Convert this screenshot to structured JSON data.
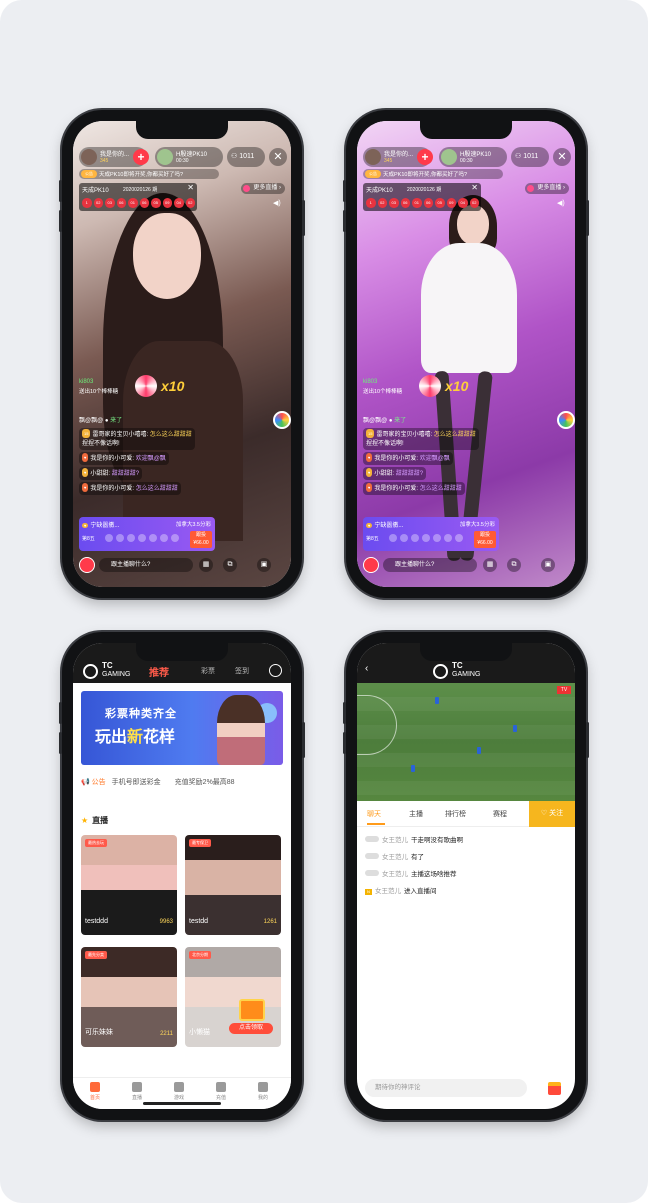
{
  "stream1": {
    "anchor_name": "我是你的...",
    "anchor_fans": "345",
    "pk_title": "H殷速PK10",
    "pk_time": "00:30",
    "viewers": "1011",
    "notice_badge": "公告",
    "notice_text": "天成PK10即将开奖,你都买好了吗?",
    "lottery_title": "天成PK10",
    "lottery_period": "2020020126 期",
    "lottery_balls": [
      "1",
      "02",
      "03",
      "06",
      "01",
      "06",
      "05",
      "09",
      "04",
      "02"
    ],
    "more_live": "更多直播",
    "gift_user": "ki803",
    "gift_text": "送出10个棒棒糖",
    "gift_multiplier": "x10",
    "chat_line1_user": "飘@飘@",
    "chat_line1_text": "来了",
    "chat_line2_lv": "15",
    "chat_line2_user": "雷哥家的宝贝小嘻嘻:",
    "chat_line2_text": "怎么这么甜甜甜",
    "chat_line2_cont": "捏捏不像话啊!",
    "chat_line3_user": "我是你的小可爱:",
    "chat_line3_text": "欢迎飘@飘",
    "chat_line4_user": "小甜甜:",
    "chat_line4_text": "甜甜甜甜?",
    "chat_line5_user": "我是你的小可爱:",
    "chat_line5_text": "怎么这么甜甜甜",
    "bet_user": "宁缺嚣擻...",
    "bet_text": "加拿大3.5分彩",
    "bet_label": "第8五",
    "bet_btn_top": "跟投",
    "bet_btn_bottom": "¥66.00",
    "chat_placeholder": "跟主播聊什么?"
  },
  "stream2": {
    "anchor_name": "我是你的...",
    "anchor_fans": "345",
    "pk_title": "H殷速PK10",
    "pk_time": "00:30",
    "viewers": "1011",
    "notice_badge": "公告",
    "notice_text": "天成PK10即将开奖,你都买好了吗?",
    "lottery_title": "天成PK10",
    "lottery_period": "2020020126 期",
    "lottery_balls": [
      "1",
      "02",
      "03",
      "06",
      "01",
      "06",
      "05",
      "09",
      "04",
      "02"
    ],
    "more_live": "更多直播",
    "gift_user": "ki803",
    "gift_text": "送出10个棒棒糖",
    "gift_multiplier": "x10",
    "chat_line1_user": "飘@飘@",
    "chat_line1_text": "来了",
    "chat_line2_lv": "15",
    "chat_line2_user": "雷哥家的宝贝小嘻嘻:",
    "chat_line2_text": "怎么这么甜甜甜",
    "chat_line2_cont": "捏捏不像话啊!",
    "chat_line3_user": "我是你的小可爱:",
    "chat_line3_text": "欢迎飘@飘",
    "chat_line4_user": "小甜甜:",
    "chat_line4_text": "甜甜甜甜?",
    "chat_line5_user": "我是你的小可爱:",
    "chat_line5_text": "怎么这么甜甜甜",
    "bet_user": "宁缺嚣擻...",
    "bet_text": "加拿大3.5分彩",
    "bet_label": "第8五",
    "bet_btn_top": "跟投",
    "bet_btn_bottom": "¥66.00",
    "chat_placeholder": "跟主播聊什么?"
  },
  "home": {
    "logo_tc": "TC",
    "logo_gaming": "GAMING",
    "tab_recommend": "推荐",
    "tab_lottery": "彩票",
    "tab_signin": "签到",
    "banner_line1": "彩票种类齐全",
    "banner_line2_a": "玩出",
    "banner_line2_hl": "新",
    "banner_line2_b": "花样",
    "ann_label": "公告",
    "ann_text": "手机号即送彩金　　充值奖励2%最高88",
    "live_title": "直播",
    "tiles": [
      {
        "tag": "最热去玩",
        "name": "testddd",
        "count": "9963"
      },
      {
        "tag": "最专保卫",
        "name": "testdd",
        "count": "1261"
      },
      {
        "tag": "最先分卖",
        "name": "可乐妹妹",
        "count": "2211"
      },
      {
        "tag": "北京分期",
        "name": "小懒猫",
        "count": ""
      }
    ],
    "redeem_label": "点击领取",
    "nav": [
      "首页",
      "直播",
      "游戏",
      "充值",
      "我的"
    ]
  },
  "sports": {
    "logo_tc": "TC",
    "logo_gaming": "GAMING",
    "tabs": [
      "聊天",
      "主播",
      "排行榜",
      "赛程"
    ],
    "follow": "关注",
    "messages": [
      {
        "user": "女王范儿",
        "text": "干走啊没有歌曲啊"
      },
      {
        "user": "女王范儿",
        "text": "有了"
      },
      {
        "user": "女王范儿",
        "text": "主播这场啥推荐"
      },
      {
        "user": "女王范儿",
        "text": "进入直播间"
      }
    ],
    "input_placeholder": "期待你的神评论"
  }
}
